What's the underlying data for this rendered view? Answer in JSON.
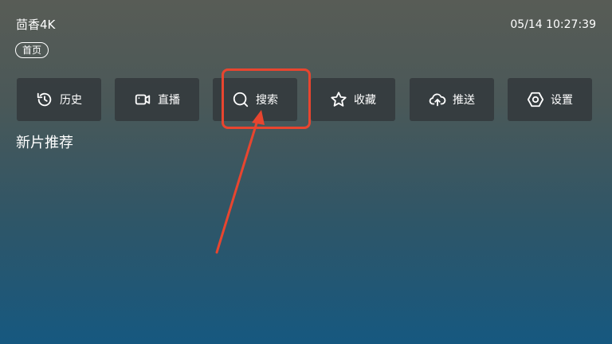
{
  "header": {
    "app_title": "茴香4K",
    "clock": "05/14 10:27:39"
  },
  "tabs": [
    {
      "label": "首页",
      "selected": true
    }
  ],
  "menu": [
    {
      "label": "历史",
      "icon": "history-icon"
    },
    {
      "label": "直播",
      "icon": "video-camera-icon"
    },
    {
      "label": "搜索",
      "icon": "search-icon"
    },
    {
      "label": "收藏",
      "icon": "star-icon"
    },
    {
      "label": "推送",
      "icon": "cloud-upload-icon"
    },
    {
      "label": "设置",
      "icon": "gear-icon"
    }
  ],
  "section": {
    "title": "新片推荐"
  },
  "annotation": {
    "color": "#e8452f"
  }
}
